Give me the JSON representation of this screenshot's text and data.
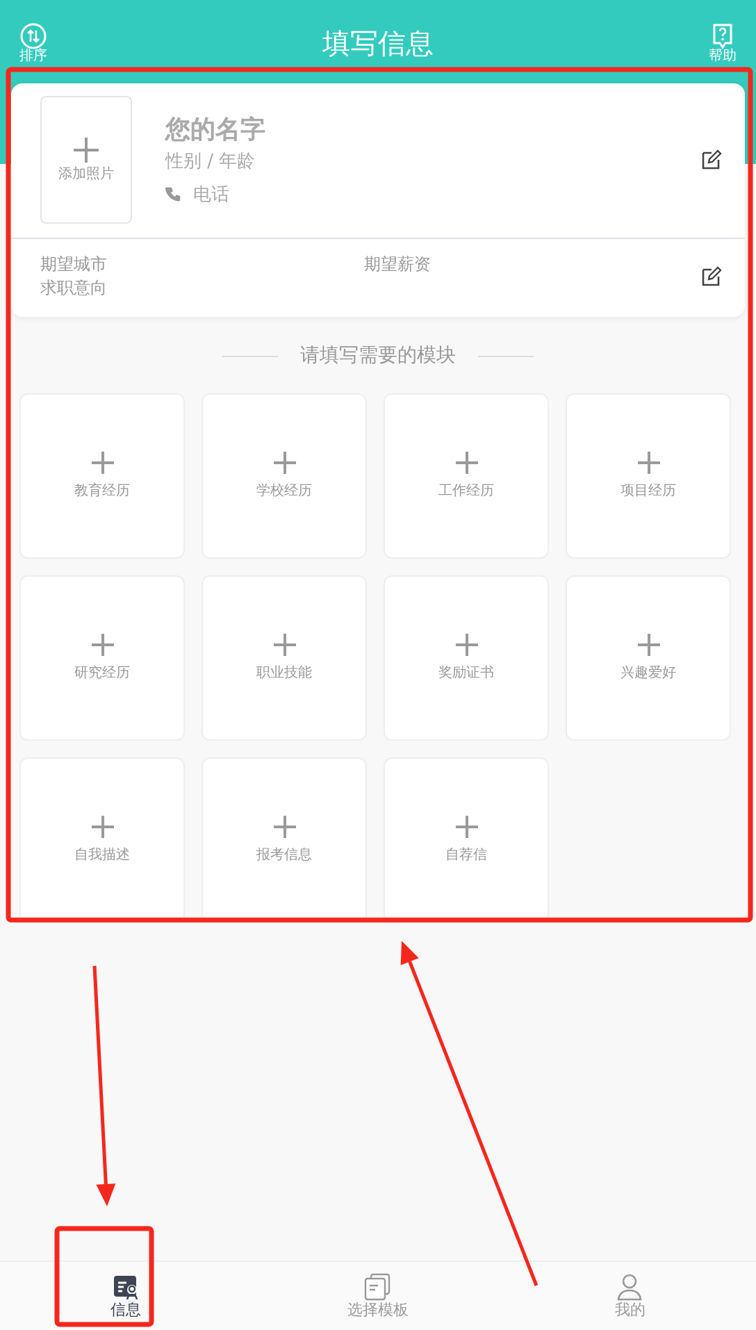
{
  "header": {
    "title": "填写信息",
    "left_action": {
      "label": "排序"
    },
    "right_action": {
      "label": "帮助"
    }
  },
  "profile": {
    "photo_label": "添加照片",
    "name": "您的名字",
    "gender_age": "性别 / 年龄",
    "phone": "电话",
    "expected_city": "期望城市",
    "job_intention": "求职意向",
    "expected_salary": "期望薪资"
  },
  "section_title": "请填写需要的模块",
  "modules": [
    {
      "label": "教育经历"
    },
    {
      "label": "学校经历"
    },
    {
      "label": "工作经历"
    },
    {
      "label": "项目经历"
    },
    {
      "label": "研究经历"
    },
    {
      "label": "职业技能"
    },
    {
      "label": "奖励证书"
    },
    {
      "label": "兴趣爱好"
    },
    {
      "label": "自我描述"
    },
    {
      "label": "报考信息"
    },
    {
      "label": "自荐信"
    }
  ],
  "tabs": [
    {
      "label": "信息",
      "selected": true
    },
    {
      "label": "选择模板",
      "selected": false
    },
    {
      "label": "我的",
      "selected": false
    }
  ],
  "annotations": [
    {
      "kind": "box"
    },
    {
      "kind": "box"
    },
    {
      "kind": "arrow"
    },
    {
      "kind": "arrow"
    }
  ]
}
